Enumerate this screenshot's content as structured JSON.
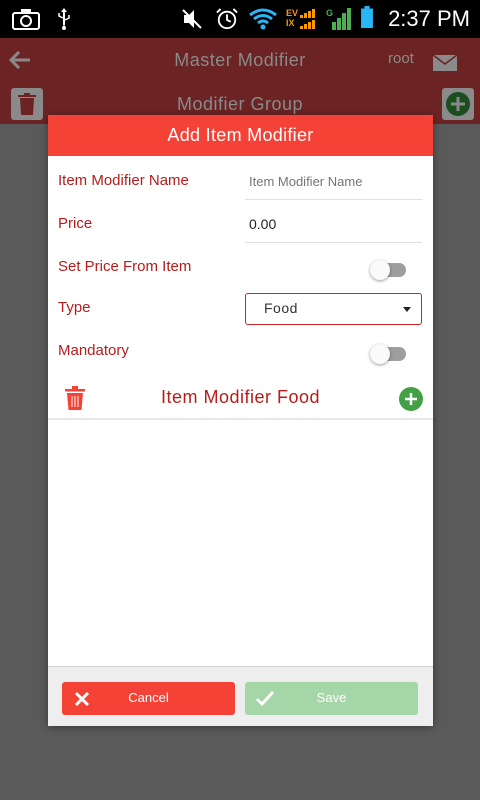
{
  "status_bar": {
    "time": "2:37 PM",
    "icons": [
      "camera-icon",
      "usb-icon",
      "mute-icon",
      "alarm-icon",
      "wifi-icon",
      "ev-ix-signal-icon",
      "g-signal-icon",
      "battery-icon"
    ],
    "network_ev": "EV",
    "network_ix": "IX",
    "network_g": "G"
  },
  "app_bar": {
    "title": "Master Modifier",
    "user": "root",
    "subtitle": "Modifier Group",
    "back_icon": "arrow-left-icon",
    "mail_icon": "mail-icon",
    "delete_icon": "trash-icon",
    "add_icon": "plus-circle-icon"
  },
  "dialog": {
    "title": "Add Item Modifier",
    "fields": {
      "name_label": "Item Modifier Name",
      "name_placeholder": "Item Modifier Name",
      "name_value": "",
      "price_label": "Price",
      "price_value": "0.00",
      "set_price_label": "Set Price From Item",
      "set_price_on": false,
      "type_label": "Type",
      "type_value": "Food",
      "mandatory_label": "Mandatory",
      "mandatory_on": false
    },
    "section": {
      "title": "Item Modifier Food"
    },
    "buttons": {
      "cancel": "Cancel",
      "save": "Save"
    }
  },
  "colors": {
    "accent": "#f44336",
    "label": "#b71c1c",
    "add_green": "#43a047",
    "save_disabled": "#a5d6a7"
  }
}
